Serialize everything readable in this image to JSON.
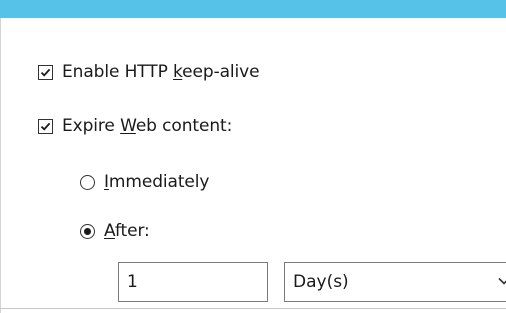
{
  "theme": {
    "title_bar_color": "#57c2e7",
    "text_color": "#1a1a1a"
  },
  "options": {
    "keep_alive": {
      "label_pre": "Enable HTTP ",
      "label_accel": "k",
      "label_post": "eep-alive",
      "checked": true
    },
    "expire_content": {
      "label_pre": "Expire ",
      "label_accel": "W",
      "label_post": "eb content:",
      "checked": true
    },
    "immediately": {
      "label_accel": "I",
      "label_post": "mmediately",
      "selected": false
    },
    "after": {
      "label_accel": "A",
      "label_post": "fter:",
      "selected": true
    }
  },
  "expire_after": {
    "value": "1",
    "unit_selected": "Day(s)",
    "unit_icon": "chevron-down-icon"
  }
}
